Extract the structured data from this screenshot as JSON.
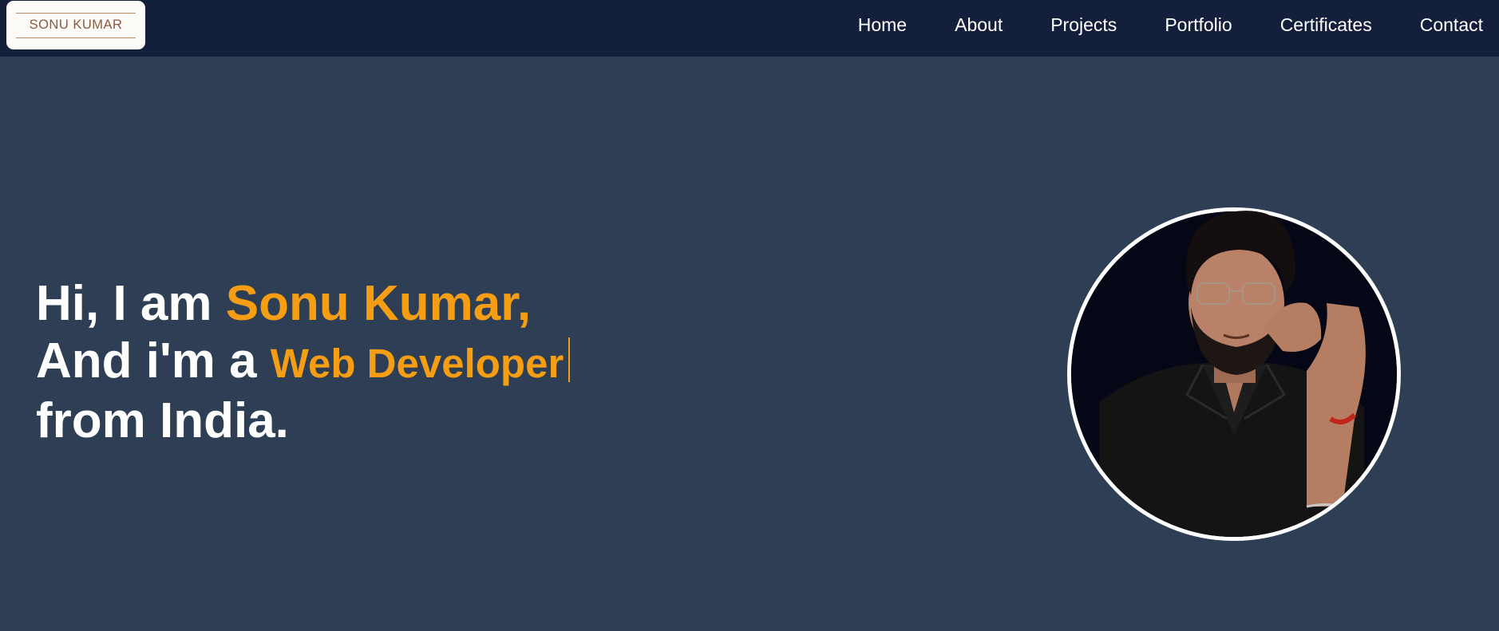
{
  "header": {
    "logo_text": "SONU KUMAR",
    "nav": [
      {
        "label": "Home"
      },
      {
        "label": "About"
      },
      {
        "label": "Projects"
      },
      {
        "label": "Portfolio"
      },
      {
        "label": "Certificates"
      },
      {
        "label": "Contact"
      }
    ]
  },
  "hero": {
    "line1_prefix": "Hi, I am ",
    "name": "Sonu Kumar,",
    "line2_prefix": "And i'm a ",
    "role": "Web Developer",
    "line3": "from India."
  },
  "profile_image": {
    "icon": "profile-photo"
  },
  "colors": {
    "background": "#2e3e54",
    "navbar": "#141f3b",
    "accent": "#f59e14",
    "text": "#ffffff"
  }
}
